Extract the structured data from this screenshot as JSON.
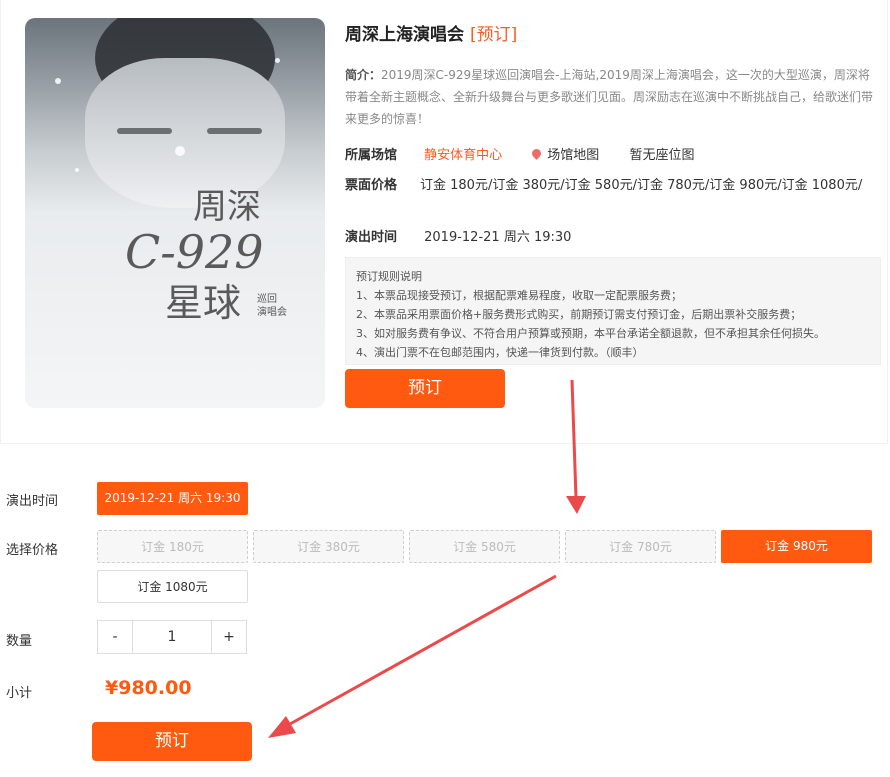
{
  "event": {
    "title": "周深上海演唱会",
    "title_tag": "[预订]",
    "intro_label": "简介：",
    "intro_text": "2019周深C-929星球巡回演唱会-上海站,2019周深上海演唱会，这一次的大型巡演，周深将带着全新主题概念、全新升级舞台与更多歌迷们见面。周深励志在巡演中不断挑战自己，给歌迷们带来更多的惊喜！",
    "venue_label": "所属场馆",
    "venue_name": "静安体育中心",
    "venue_map": "场馆地图",
    "seat_map": "暂无座位图",
    "price_label": "票面价格",
    "price_list": "订金 180元/订金 380元/订金 580元/订金 780元/订金 980元/订金 1080元/",
    "time_label": "演出时间",
    "time_value": "2019-12-21 周六 19:30"
  },
  "poster": {
    "line1": "周深",
    "line2": "C-929",
    "line3": "星球",
    "sub1": "巡回",
    "sub2": "演唱会"
  },
  "rules": {
    "title": "预订规则说明",
    "items": [
      "1、本票品现接受预订，根据配票难易程度，收取一定配票服务费；",
      "2、本票品采用票面价格+服务费形式购买，前期预订需支付预订金，后期出票补交服务费；",
      "3、如对服务费有争议、不符合用户预算或预期，本平台承诺全额退款，但不承担其余任何损失。",
      "4、演出门票不在包邮范围内，快递一律货到付款。（顺丰）"
    ]
  },
  "buttons": {
    "book_top": "预订",
    "book_bottom": "预订"
  },
  "selection": {
    "time_label": "演出时间",
    "time_option": "2019-12-21 周六 19:30",
    "price_label": "选择价格",
    "prices": [
      {
        "label": "订金 180元",
        "state": "disabled"
      },
      {
        "label": "订金 380元",
        "state": "disabled"
      },
      {
        "label": "订金 580元",
        "state": "disabled"
      },
      {
        "label": "订金 780元",
        "state": "disabled"
      },
      {
        "label": "订金 980元",
        "state": "selected"
      },
      {
        "label": "订金 1080元",
        "state": "normal"
      }
    ],
    "qty_label": "数量",
    "qty_minus": "-",
    "qty_value": "1",
    "qty_plus": "+",
    "subtotal_label": "小计",
    "subtotal_value": "¥980.00"
  },
  "colors": {
    "accent": "#ff5a10",
    "arrow": "#ec4a4a"
  }
}
